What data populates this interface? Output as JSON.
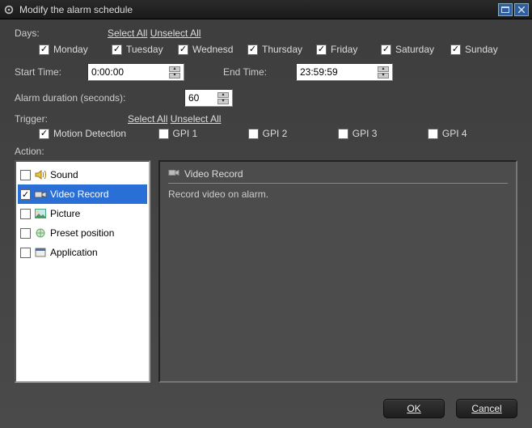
{
  "title": "Modify the alarm schedule",
  "days": {
    "label": "Days:",
    "select_all": "Select All",
    "unselect_all": "Unselect All",
    "items": [
      {
        "label": "Monday",
        "checked": true
      },
      {
        "label": "Tuesday",
        "checked": true
      },
      {
        "label": "Wednesday",
        "display": "Wednesd",
        "checked": true
      },
      {
        "label": "Thursday",
        "checked": true
      },
      {
        "label": "Friday",
        "checked": true
      },
      {
        "label": "Saturday",
        "checked": true
      },
      {
        "label": "Sunday",
        "checked": true
      }
    ]
  },
  "start_time": {
    "label": "Start Time:",
    "value": "0:00:00"
  },
  "end_time": {
    "label": "End Time:",
    "value": "23:59:59"
  },
  "duration": {
    "label": "Alarm duration (seconds):",
    "value": "60"
  },
  "trigger": {
    "label": "Trigger:",
    "select_all": "Select All",
    "unselect_all": "Unselect All",
    "items": [
      {
        "label": "Motion Detection",
        "display": "Motion Detection",
        "checked": true
      },
      {
        "label": "GPI 1",
        "checked": false
      },
      {
        "label": "GPI 2",
        "checked": false
      },
      {
        "label": "GPI 3",
        "checked": false
      },
      {
        "label": "GPI 4",
        "checked": false
      }
    ]
  },
  "action": {
    "label": "Action:",
    "items": [
      {
        "label": "Sound",
        "checked": false,
        "icon": "speaker-icon"
      },
      {
        "label": "Video Record",
        "checked": true,
        "icon": "camera-icon",
        "selected": true
      },
      {
        "label": "Picture",
        "checked": false,
        "icon": "picture-icon"
      },
      {
        "label": "Preset position",
        "checked": false,
        "icon": "preset-icon"
      },
      {
        "label": "Application",
        "checked": false,
        "icon": "application-icon"
      }
    ],
    "detail": {
      "title": "Video Record",
      "description": "Record video on alarm."
    }
  },
  "buttons": {
    "ok": "OK",
    "cancel": "Cancel"
  }
}
